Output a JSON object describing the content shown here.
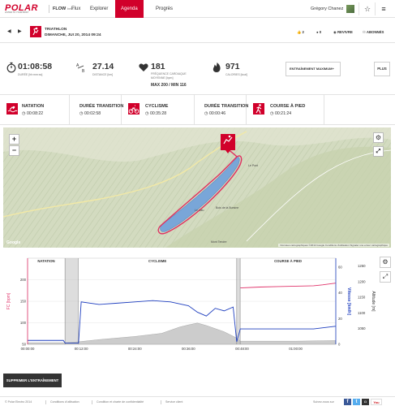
{
  "nav": {
    "logo": "POLAR",
    "logo_tagline": "LISTEN TO YOUR BODY",
    "product": "FLOW",
    "product_tag": "beta",
    "items": [
      "Flux",
      "Explorer",
      "Agenda",
      "Progrès"
    ],
    "active": "Agenda",
    "user_name": "Grégory Chanez"
  },
  "session": {
    "sport": "TRIATHLON",
    "date": "DIMANCHE, JUI 20, 2014 09:24",
    "likes": "2",
    "comments": "0",
    "review_label": "REVIVRE",
    "subscribers_label": "ABONNÉS"
  },
  "summary": {
    "duration": {
      "value": "01:08:58",
      "label": "DURÉE [hh:mm:ss]"
    },
    "distance": {
      "value": "27.14",
      "label": "DISTANCE [km]"
    },
    "heart_rate": {
      "value": "181",
      "label": "FRÉQUENCE CARDIAQUE MOYENNE [bpm]",
      "max_label": "MAX",
      "max": "200",
      "min_label": "MIN",
      "min": "116"
    },
    "calories": {
      "value": "971",
      "label": "CALORIES [kcal]"
    },
    "dropdown": "ENTRAÎNEMENT MAXIMUM+",
    "plus": "PLUS"
  },
  "segments": [
    {
      "title": "NATATION",
      "time": "00:08:22",
      "icon": "swim-icon"
    },
    {
      "title": "DURÉE TRANSITION",
      "time": "00:02:58",
      "icon": "clock-icon"
    },
    {
      "title": "CYCLISME",
      "time": "00:35:28",
      "icon": "bike-icon"
    },
    {
      "title": "DURÉE TRANSITION",
      "time": "00:00:46",
      "icon": "clock-icon"
    },
    {
      "title": "COURSE À PIED",
      "time": "00:21:24",
      "icon": "run-icon"
    }
  ],
  "map": {
    "credit": "Données cartographiques ©2014 Google   Conditions d'utilisation   Signaler une erreur cartographique",
    "google": "Google",
    "places": [
      "Le Pont",
      "Les Charbonnières",
      "L'Abbaye",
      "Le Lieu",
      "Le Brassus",
      "Le Sentier",
      "Bois de la Bursine"
    ]
  },
  "chart_data": {
    "type": "line",
    "x_ticks": [
      "00:00:00",
      "00:12:00",
      "00:24:00",
      "00:36:00",
      "00:48:00",
      "01:00:00"
    ],
    "x_range": [
      0,
      68.97
    ],
    "segment_labels": [
      "NATATION",
      "CYCLISME",
      "COURSE À PIED"
    ],
    "segment_bounds": [
      0,
      8.37,
      11.33,
      46.8,
      47.57,
      68.97
    ],
    "left_axis": {
      "label": "FC [bpm]",
      "ticks": [
        50,
        100,
        150,
        200
      ],
      "range": [
        50,
        250
      ]
    },
    "right_axis_1": {
      "label": "Vitesse [km/h]",
      "ticks": [
        0,
        20,
        40,
        60
      ],
      "range": [
        0,
        67
      ]
    },
    "right_axis_2": {
      "label": "Altitude [m]",
      "ticks": [
        1050,
        1100,
        1150,
        1200,
        1250
      ],
      "range": [
        1000,
        1275
      ]
    },
    "series": [
      {
        "name": "FC",
        "color": "#e0336a",
        "x": [
          47.6,
          52,
          56,
          60,
          64,
          66,
          68.9
        ],
        "y": [
          181,
          183,
          184,
          185,
          186,
          188,
          192
        ]
      },
      {
        "name": "Vitesse",
        "color": "#1f3fbf",
        "x": [
          0,
          4,
          8,
          8.4,
          11.4,
          12,
          16,
          20,
          24,
          28,
          32,
          36,
          38,
          40,
          42,
          44,
          46,
          46.8,
          47.6,
          52,
          56,
          60,
          64,
          68.9
        ],
        "y": [
          3,
          3,
          3,
          1,
          1,
          33,
          31,
          32,
          33,
          34,
          33,
          30,
          25,
          22,
          28,
          26,
          29,
          2,
          12,
          12,
          12,
          12,
          12,
          14
        ]
      },
      {
        "name": "Altitude",
        "color": "#cccccc",
        "x": [
          0,
          8.4,
          11.4,
          16,
          24,
          30,
          34,
          36,
          38,
          40,
          44,
          46.8,
          47.6,
          60,
          68.9
        ],
        "y": [
          1005,
          1005,
          1008,
          1015,
          1025,
          1035,
          1055,
          1062,
          1068,
          1060,
          1040,
          1020,
          1010,
          1010,
          1012
        ]
      }
    ]
  },
  "actions": {
    "delete": "SUPPRIMER L'ENTRAÎNEMENT"
  },
  "footer": {
    "links": [
      "© Polar Electro 2014",
      "Conditions d'utilisation",
      "Condition et charte de confidentialité",
      "Service client"
    ],
    "follow": "Suivez-nous sur"
  }
}
